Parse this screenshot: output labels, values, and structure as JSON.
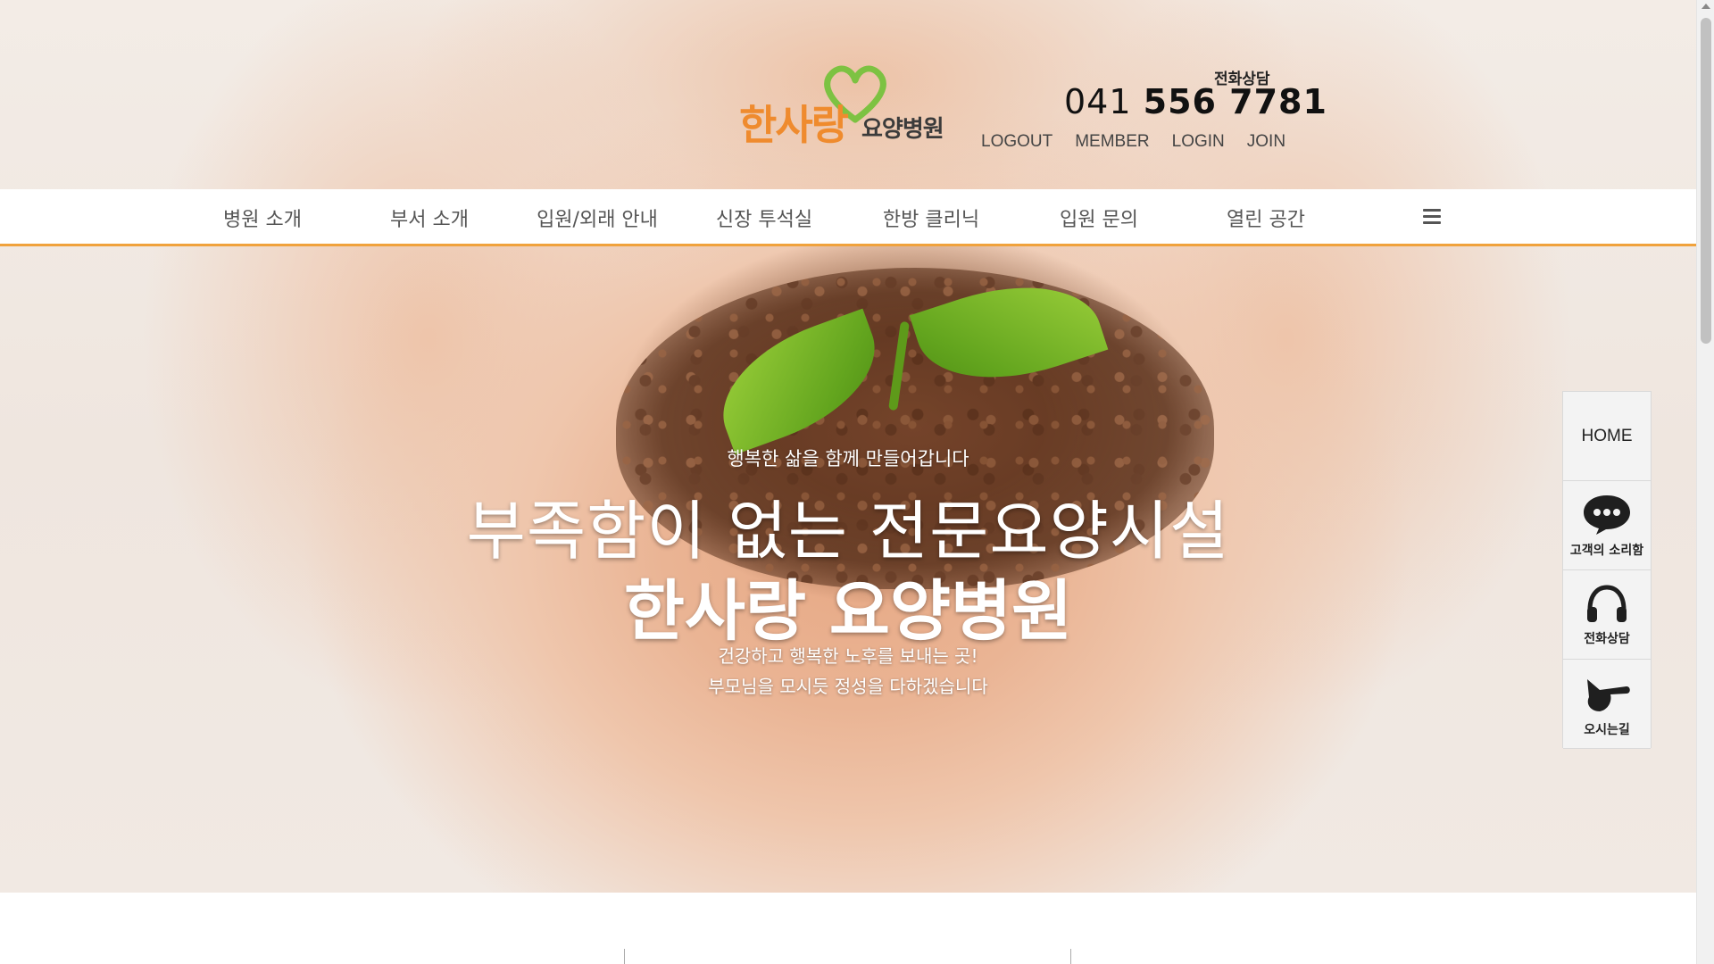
{
  "header": {
    "logo_main": "한사랑",
    "logo_sub": "요양병원",
    "phone_label": "전화상담",
    "phone_area": "041",
    "phone_rest": "556 7781",
    "top_links": [
      "LOGOUT",
      "MEMBER",
      "LOGIN",
      "JOIN"
    ]
  },
  "nav": {
    "items": [
      "병원 소개",
      "부서 소개",
      "입원/외래 안내",
      "신장 투석실",
      "한방 클리닉",
      "입원 문의",
      "열린 공간"
    ],
    "menu_icon": "hamburger-menu-icon"
  },
  "hero": {
    "subtitle": "행복한 삶을 함께 만들어갑니다",
    "title_line1": "부족함이 없는 전문요양시설",
    "title_line2": "한사랑 요양병원",
    "desc_line1": "건강하고 행복한 노후를 보내는 곳!",
    "desc_line2": "부모님을 모시듯 정성을 다하겠습니다"
  },
  "quick_menu": {
    "home": "HOME",
    "voice": "고객의 소리함",
    "phone": "전화상담",
    "directions": "오시는길"
  },
  "colors": {
    "brand_orange": "#ef8b2e",
    "nav_border": "#f0a23c",
    "logo_heart": "#7dc242"
  }
}
